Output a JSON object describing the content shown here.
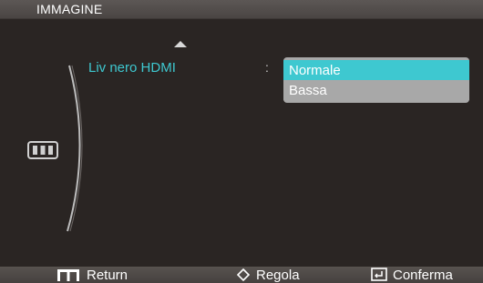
{
  "header": {
    "title": "IMMAGINE"
  },
  "menu": {
    "item_label": "Liv nero HDMI",
    "separator": ":",
    "options": [
      "Normale",
      "Bassa"
    ],
    "selected": "Normale"
  },
  "footer": {
    "return_label": "Return",
    "adjust_label": "Regola",
    "confirm_label": "Conferma"
  },
  "icons": {
    "scroll_up": "arrow-up-icon",
    "side": "monitor-menu-icon",
    "return": "menu-m-icon",
    "adjust": "diamond-arrows-icon",
    "confirm": "enter-icon"
  },
  "colors": {
    "accent": "#3ec8d0",
    "background": "#2a2523",
    "dropdown": "#a8a8a8",
    "bar": "#4a4543"
  }
}
